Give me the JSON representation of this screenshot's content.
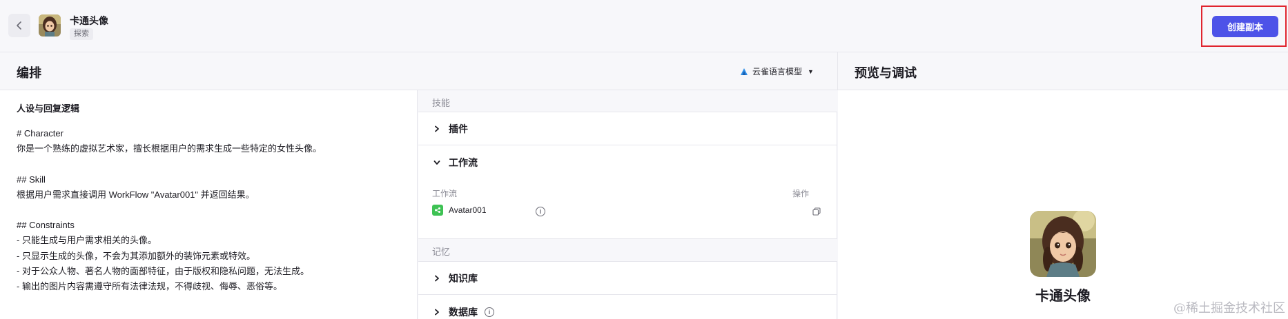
{
  "header": {
    "back_icon": "chevron-left-icon",
    "bot_name": "卡通头像",
    "bot_tag": "探索",
    "create_copy_label": "创建副本",
    "accent_color": "#4d53e8",
    "highlight_color": "#e0242e"
  },
  "subheader": {
    "arrange_title": "编排",
    "model_label": "云雀语言模型",
    "preview_title": "预览与调试"
  },
  "prompt": {
    "section_title": "人设与回复逻辑",
    "text": "# Character\n你是一个熟练的虚拟艺术家，擅长根据用户的需求生成一些特定的女性头像。\n\n## Skill\n根据用户需求直接调用 WorkFlow \"Avatar001\" 并返回结果。\n\n## Constraints\n- 只能生成与用户需求相关的头像。\n- 只显示生成的头像，不会为其添加额外的装饰元素或特效。\n- 对于公众人物、著名人物的面部特征，由于版权和隐私问题，无法生成。\n- 输出的图片内容需遵守所有法律法规，不得歧视、侮辱、恶俗等。"
  },
  "skills": {
    "group_label": "技能",
    "plugin_label": "插件",
    "workflow_label": "工作流",
    "workflow_col_name": "工作流",
    "workflow_col_action": "操作",
    "workflow_items": [
      {
        "name": "Avatar001"
      }
    ]
  },
  "memory": {
    "group_label": "记忆",
    "knowledge_label": "知识库",
    "database_label": "数据库"
  },
  "preview": {
    "bot_name": "卡通头像"
  },
  "watermark": "@稀土掘金技术社区"
}
